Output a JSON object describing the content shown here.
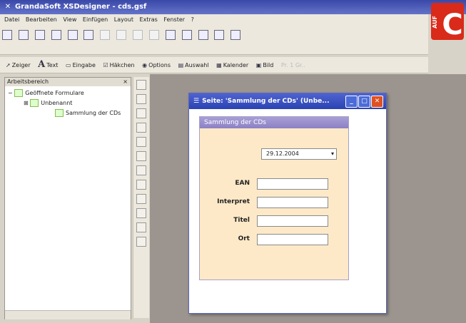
{
  "app": {
    "title": "GrandaSoft XSDesigner - cds.gsf",
    "menu": [
      "Datei",
      "Bearbeiten",
      "View",
      "Einfügen",
      "Layout",
      "Extras",
      "Fenster",
      "?"
    ]
  },
  "toolbar2": {
    "pointer": "Zeiger",
    "text": "Text",
    "input": "Eingabe",
    "checkbox": "Häkchen",
    "options": "Options",
    "selection": "Auswahl",
    "calendar": "Kalender",
    "image": "Bild",
    "faded": "Pr. 1 Gr.."
  },
  "workspace_panel": {
    "header": "Arbeitsbereich",
    "close": "×",
    "tree": [
      {
        "label": "Geöffnete Formulare",
        "expander": "−"
      },
      {
        "label": "Unbenannt",
        "expander": "⊞"
      },
      {
        "label": "Sammlung der CDs",
        "expander": ""
      }
    ]
  },
  "document": {
    "title": "Seite: 'Sammlung der CDs' (Unbe...",
    "minimize": "_",
    "maximize": "□",
    "close": "✕",
    "form_header": "Sammlung der CDs",
    "date_value": "29.12.2004",
    "date_dropdown": "▾",
    "fields": [
      {
        "label": "EAN",
        "value": ""
      },
      {
        "label": "Interpret",
        "value": ""
      },
      {
        "label": "Titel",
        "value": ""
      },
      {
        "label": "Ort",
        "value": ""
      }
    ]
  },
  "logo": {
    "letter": "C",
    "text": "AUF"
  },
  "colors": {
    "titlebar": "#3a48a8",
    "doc_title": "#2b43b2",
    "close_button": "#e05020",
    "form_bg": "#fde9c8",
    "form_header": "#8c80c4",
    "logo_red": "#d92a1a"
  }
}
